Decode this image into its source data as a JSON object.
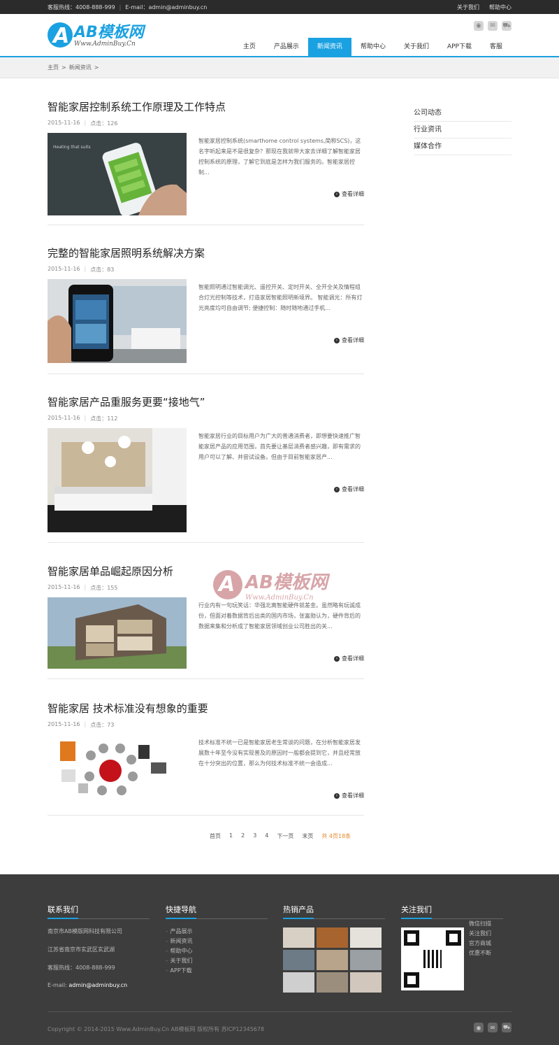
{
  "topbar": {
    "hotline": "客服热线：4008-888-999",
    "email": "E-mail：admin@adminbuy.cn",
    "links": [
      "关于我们",
      "帮助中心"
    ]
  },
  "logo": {
    "mark": "A",
    "text": "AB模板网",
    "url_text": "Www.AdminBuy.Cn"
  },
  "util_icons": [
    "weibo-icon",
    "wechat-icon",
    "cart-icon"
  ],
  "nav": [
    "主页",
    "产品展示",
    "新闻资讯",
    "帮助中心",
    "关于我们",
    "APP下载",
    "客服"
  ],
  "nav_active_index": 2,
  "breadcrumb": [
    "主页",
    "新闻资讯"
  ],
  "breadcrumb_sep": ">",
  "articles": [
    {
      "title": "智能家居控制系统工作原理及工作特点",
      "date": "2015-11-16",
      "clicks": "点击：126",
      "excerpt": "智能家居控制系统(smarthome control systems,简称SCS)，这名字听起来是不是很复杂？那现在我就带大家去详细了解智能家居控制系统的原理，了解它到底是怎样为我们服务的。智能家居控制...",
      "more": "查看详细"
    },
    {
      "title": "完整的智能家居照明系统解决方案",
      "date": "2015-11-16",
      "clicks": "点击：83",
      "excerpt": "智能照明通过智能调光、遥控开关、定时开关、全开全关及情程组合灯光控制等技术，打造家居智能照明新境界。 智能调光：所有灯光亮度均可自由调节; 便捷控制：随时随地通过手机...",
      "more": "查看详细"
    },
    {
      "title": "智能家居产品重服务更要“接地气”",
      "date": "2015-11-16",
      "clicks": "点击：112",
      "excerpt": "智能家居行业的目标用户为广大的普通消费者，即想要快速推广智能家居产品的应用范围，首先要让基层消费者感兴趣，即有需求的用户可以了解、并尝试设备。但由于目前智能家居产...",
      "more": "查看详细"
    },
    {
      "title": "智能家居单品崛起原因分析",
      "date": "2015-11-16",
      "clicks": "点击：155",
      "excerpt": "行业内有一句玩笑话：华强北离智能硬件就差金。虽然略有玩诚成份，但面对着数据背后出类的国内市场，张富勋认为，硬件背后的数据来集和分析成了智能家居领域创业公司胜出的关...",
      "more": "查看详细"
    },
    {
      "title": "智能家居 技术标准没有想象的重要",
      "date": "2015-11-16",
      "clicks": "点击：73",
      "excerpt": "技术标准不统一已是智能家居老生常谈的问题，在分析智能家居发展数十年至今没有实现普及的原因时一般都会提到它，并且经常放在十分突出的位置，那么为何技术标准不统一会造成...",
      "more": "查看详细"
    }
  ],
  "sidebar": [
    "公司动态",
    "行业资讯",
    "媒体合作"
  ],
  "pager": {
    "items": [
      "首页",
      "1",
      "2",
      "3",
      "4",
      "下一页",
      "末页"
    ],
    "total": "共 4页18条"
  },
  "watermark": {
    "mark": "A",
    "text": "AB模板网",
    "url_text": "Www.AdminBuy.Cn"
  },
  "footer": {
    "contact": {
      "title": "联系我们",
      "company": "南京市AB模版网科技有限公司",
      "address": "江苏省南京市玄武区玄武湖",
      "hotline": "客服热线：4008-888-999",
      "email_label": "E-mail:",
      "email": "admin@adminbuy.cn"
    },
    "quick": {
      "title": "快捷导航",
      "links": [
        "产品展示",
        "新闻资讯",
        "帮助中心",
        "关于我们",
        "APP下载"
      ]
    },
    "hot": {
      "title": "热销产品",
      "count": 9
    },
    "follow": {
      "title": "关注我们",
      "lines": [
        "微信扫描",
        "关注我们",
        "官方商城",
        "优惠不断"
      ]
    },
    "copyright": "Copyright © 2014-2015 Www.AdminBuy.Cn AB模板网 版权所有 苏ICP12345678",
    "icons": [
      "weibo-icon",
      "wechat-icon",
      "cart-icon"
    ]
  },
  "colors": {
    "accent": "#1aa1e1",
    "footer_bg": "#3d3d3d",
    "pager_total": "#e58a2b"
  }
}
